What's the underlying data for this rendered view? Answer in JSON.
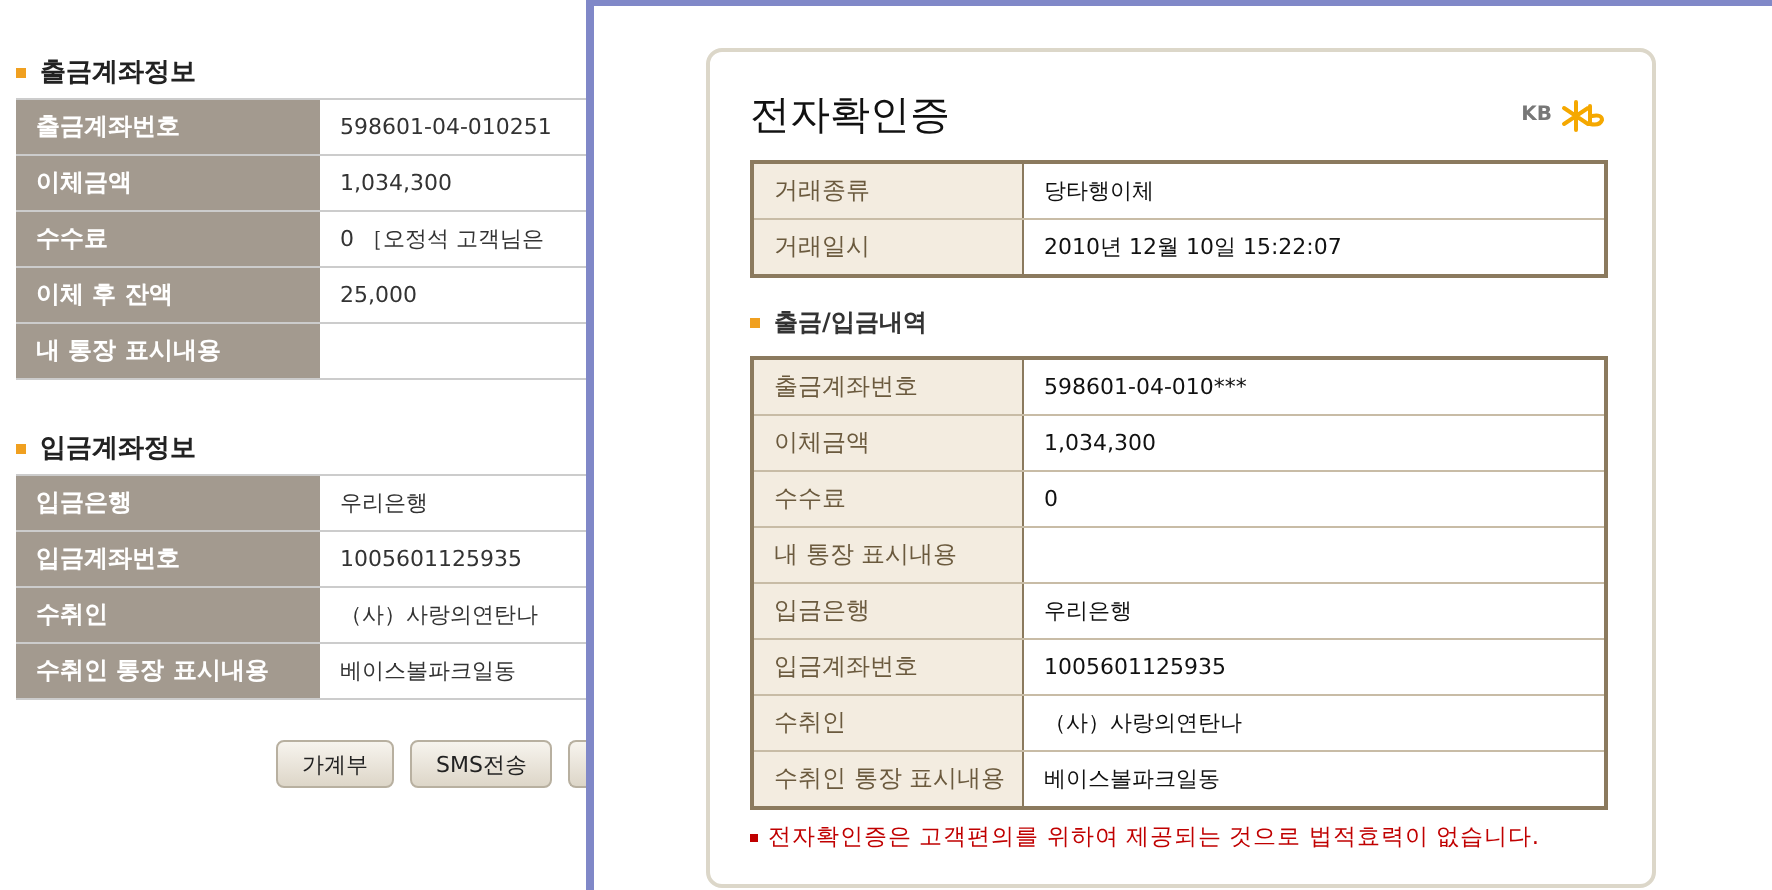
{
  "page": {
    "sections": [
      {
        "title": "출금계좌정보",
        "rows": [
          {
            "label": "출금계좌번호",
            "value": "598601-04-010251"
          },
          {
            "label": "이체금액",
            "value": "1,034,300"
          },
          {
            "label": "수수료",
            "value": "0 ［오정석 고객님은"
          },
          {
            "label": "이체 후 잔액",
            "value": "25,000"
          },
          {
            "label": "내 통장 표시내용"
          }
        ]
      },
      {
        "title": "입금계좌정보",
        "rows": [
          {
            "label": "입금은행",
            "value": "우리은행"
          },
          {
            "label": "입금계좌번호",
            "value": "1005601125935"
          },
          {
            "label": "수취인",
            "value": "（사）사랑의연탄나"
          },
          {
            "label": "수취인 통장 표시내용",
            "value": "베이스볼파크일동"
          }
        ]
      }
    ],
    "buttons": [
      "가계부",
      "SMS전송"
    ]
  },
  "popup": {
    "title": "전자확인증",
    "logo": "KB",
    "summary": [
      {
        "label": "거래종류",
        "value": "당타행이체"
      },
      {
        "label": "거래일시",
        "value": "2010년 12월 10일 15:22:07"
      }
    ],
    "details_title": "출금/입금내역",
    "details": [
      {
        "label": "출금계좌번호",
        "value": "598601-04-010***"
      },
      {
        "label": "이체금액",
        "value": "1,034,300"
      },
      {
        "label": "수수료",
        "value": "0"
      },
      {
        "label": "내 통장 표시내용"
      },
      {
        "label": "입금은행",
        "value": "우리은행"
      },
      {
        "label": "입금계좌번호",
        "value": "1005601125935"
      },
      {
        "label": "수취인",
        "value": "（사）사랑의연탄나"
      },
      {
        "label": "수취인 통장 표시내용",
        "value": "베이스볼파크일동"
      }
    ],
    "note": "전자확인증은 고객편의를 위하여 제공되는 것으로 법적효력이 없습니다."
  }
}
